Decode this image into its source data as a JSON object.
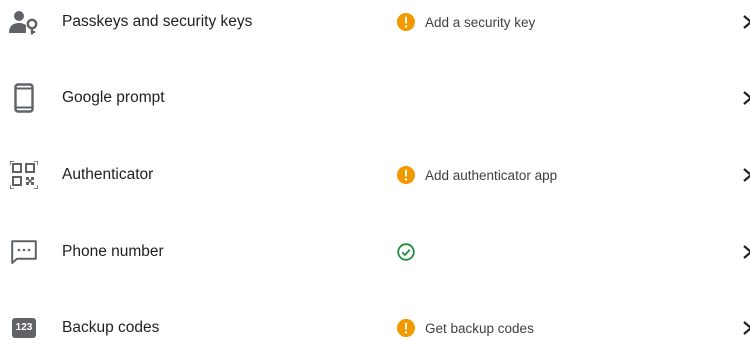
{
  "rows": [
    {
      "title": "Passkeys and security keys",
      "icon": "passkey-person-key-icon",
      "status": "warning",
      "status_text": "Add a security key"
    },
    {
      "title": "Google prompt",
      "icon": "smartphone-icon",
      "status": "none",
      "status_text": ""
    },
    {
      "title": "Authenticator",
      "icon": "qr-code-icon",
      "status": "warning",
      "status_text": "Add authenticator app"
    },
    {
      "title": "Phone number",
      "icon": "sms-message-icon",
      "status": "ok",
      "status_text": ""
    },
    {
      "title": "Backup codes",
      "icon": "backup-codes-123-icon",
      "icon_text": "123",
      "status": "warning",
      "status_text": "Get backup codes"
    }
  ],
  "colors": {
    "warning": "#f29900",
    "ok": "#1e8e3e",
    "icon": "#5f6368",
    "text": "#202124"
  }
}
